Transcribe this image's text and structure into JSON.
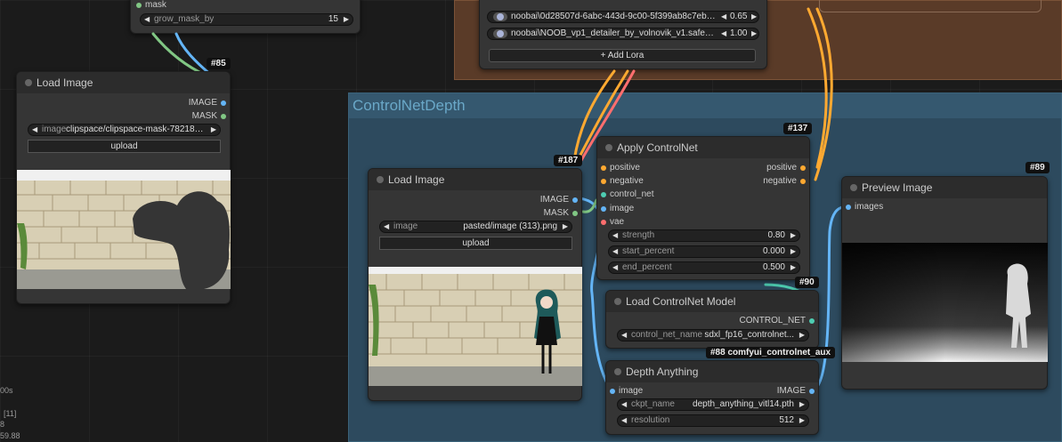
{
  "groups": {
    "controlnet_depth": {
      "title": "ControlNetDepth",
      "color": "#2d4a5e"
    },
    "lora_group": {
      "color": "#5a3b28"
    }
  },
  "colors": {
    "conditioning": "#ffa931",
    "mask": "#81c784",
    "image": "#64b5f6",
    "control_net": "#4ecdb2",
    "vae": "#ff6e6e"
  },
  "nodes": {
    "top_mask": {
      "slot_mask": "mask",
      "grow_label": "grow_mask_by",
      "grow_value": "15"
    },
    "load_image_85": {
      "badge": "#85",
      "title": "Load Image",
      "out_image": "IMAGE",
      "out_mask": "MASK",
      "image_label": "image",
      "image_value": "clipspace/clipspace-mask-782185...",
      "upload": "upload"
    },
    "lora_loader": {
      "loras": [
        {
          "name": "noobai\\0d28507d-6abc-443d-9c00-5f399ab8c7eb.TA_t...",
          "strength": "0.65"
        },
        {
          "name": "noobai\\NOOB_vp1_detailer_by_volnovik_v1.safetensors",
          "strength": "1.00"
        }
      ],
      "add": "+ Add Lora"
    },
    "load_image_187": {
      "badge": "#187",
      "title": "Load Image",
      "out_image": "IMAGE",
      "out_mask": "MASK",
      "image_label": "image",
      "image_value": "pasted/image (313).png",
      "upload": "upload"
    },
    "apply_controlnet": {
      "badge": "#137",
      "title": "Apply ControlNet",
      "in_positive": "positive",
      "in_negative": "negative",
      "in_control_net": "control_net",
      "in_image": "image",
      "in_vae": "vae",
      "out_positive": "positive",
      "out_negative": "negative",
      "strength_label": "strength",
      "strength_value": "0.80",
      "start_label": "start_percent",
      "start_value": "0.000",
      "end_label": "end_percent",
      "end_value": "0.500"
    },
    "load_controlnet": {
      "badge": "#90",
      "title": "Load ControlNet Model",
      "out": "CONTROL_NET",
      "name_label": "control_net_name",
      "name_value": "sdxl_fp16_controlnet..."
    },
    "depth_anything": {
      "badge": "#88 comfyui_controlnet_aux",
      "title": "Depth Anything",
      "in_image": "image",
      "out_image": "IMAGE",
      "ckpt_label": "ckpt_name",
      "ckpt_value": "depth_anything_vitl14.pth",
      "res_label": "resolution",
      "res_value": "512"
    },
    "preview_image": {
      "badge": "#89",
      "title": "Preview Image",
      "in_images": "images"
    }
  },
  "stats": [
    "00s",
    "[11]",
    "8",
    "59.88"
  ]
}
